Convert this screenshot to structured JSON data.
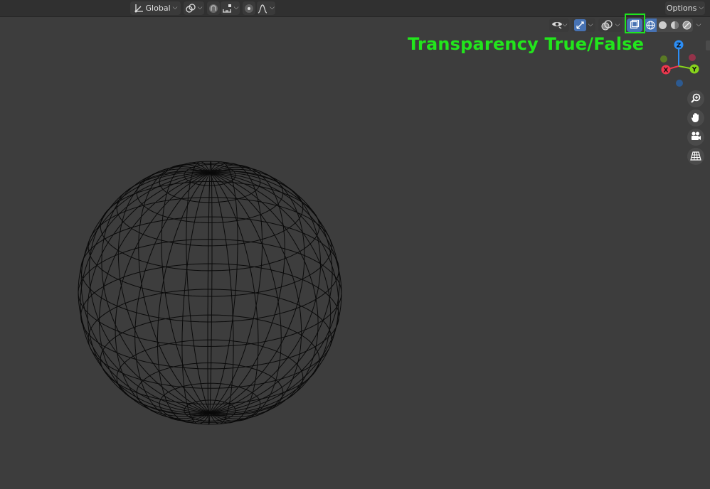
{
  "header": {
    "transform_orientation": "Global",
    "options_label": "Options"
  },
  "annotation": {
    "callout_text": "Transparency True/False"
  },
  "gizmo": {
    "x_label": "X",
    "y_label": "Y",
    "z_label": "Z",
    "colors": {
      "x": "#f0374e",
      "y": "#87d41c",
      "z": "#2c8ef6"
    }
  },
  "icons": {
    "header": [
      "transform-orientation-icon",
      "pivot-point-icon",
      "snap-icon",
      "snap-target-icon",
      "proportional-edit-icon",
      "falloff-icon"
    ],
    "viewport": [
      "visibility-eye-icon",
      "gizmo-toggle-icon",
      "overlays-icon",
      "xray-toggle-icon",
      "wireframe-shading-icon",
      "solid-shading-icon",
      "material-shading-icon",
      "rendered-shading-icon"
    ],
    "navigation": [
      "zoom-icon",
      "pan-hand-icon",
      "camera-icon",
      "grid-perspective-icon"
    ]
  },
  "viewport": {
    "object": "uv-sphere-wireframe",
    "background": "#3d3d3d",
    "wire_color": "#0a0a0a"
  }
}
